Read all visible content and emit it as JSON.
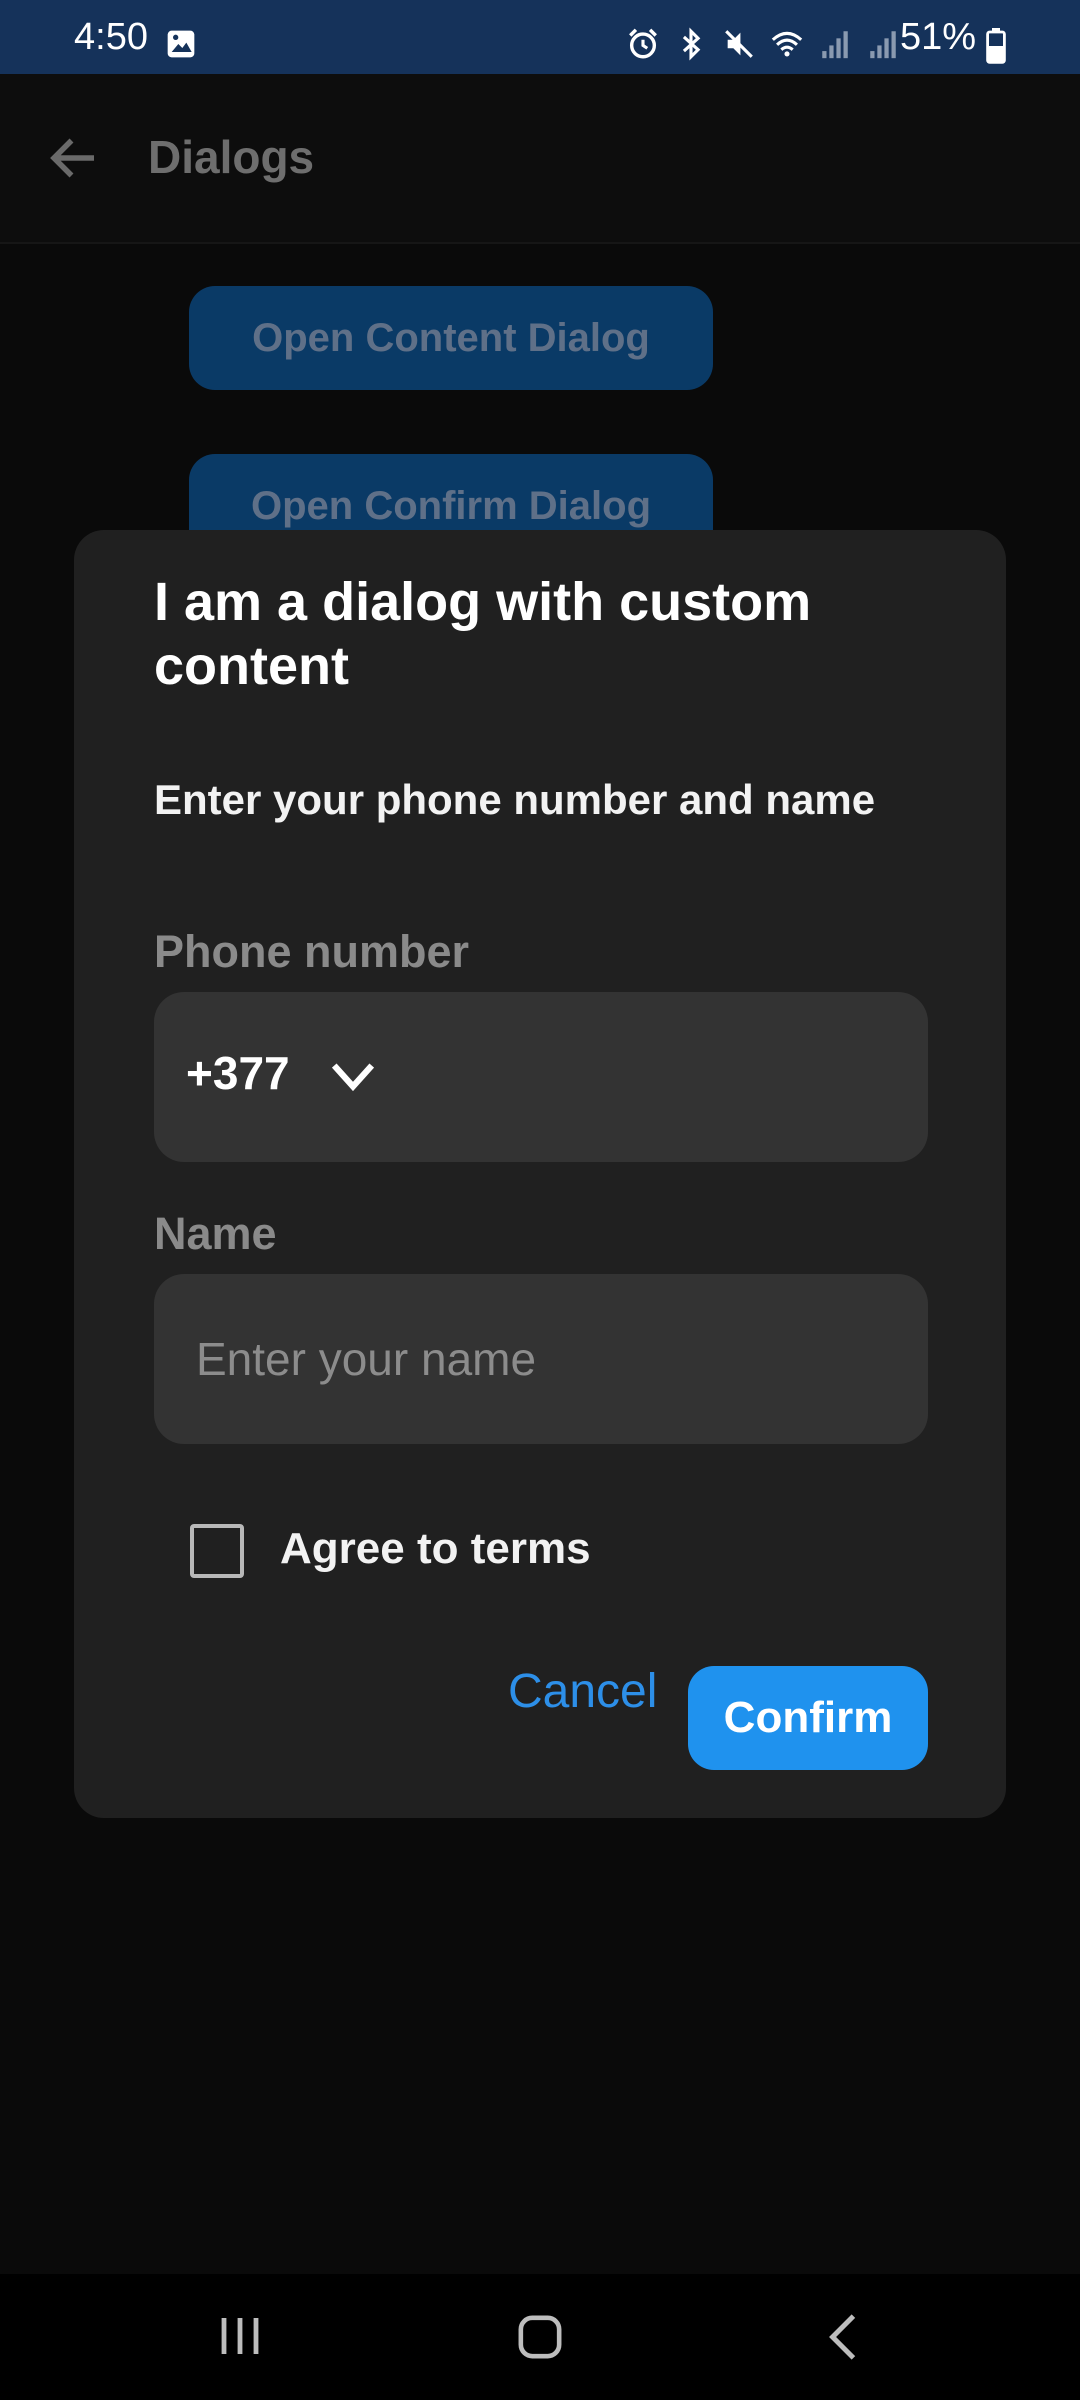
{
  "status_bar": {
    "time": "4:50",
    "battery": "51%",
    "icons": [
      "gallery-icon",
      "alarm-icon",
      "bluetooth-icon",
      "mute-icon",
      "wifi-icon",
      "signal-icon",
      "signal-icon",
      "battery-icon"
    ]
  },
  "app_bar": {
    "title": "Dialogs",
    "back_icon": "arrow-left-icon"
  },
  "background_buttons": [
    {
      "label": "Open Content Dialog"
    },
    {
      "label": "Open Confirm Dialog"
    }
  ],
  "dialog": {
    "title": "I am a dialog with custom content",
    "subtitle": "Enter your phone number and name",
    "phone": {
      "label": "Phone number",
      "country_code": "+377",
      "dropdown_icon": "chevron-down-icon"
    },
    "name": {
      "label": "Name",
      "value": "",
      "placeholder": "Enter your name"
    },
    "agree": {
      "label": "Agree to terms",
      "checked": false
    },
    "cancel_label": "Cancel",
    "confirm_label": "Confirm"
  },
  "colors": {
    "accent": "#1f92ee",
    "dialog_bg": "#202020",
    "field_bg": "#333333",
    "status_bar_bg": "#15325a"
  },
  "nav_bar": {
    "icons": [
      "recents-icon",
      "home-icon",
      "back-icon"
    ]
  }
}
